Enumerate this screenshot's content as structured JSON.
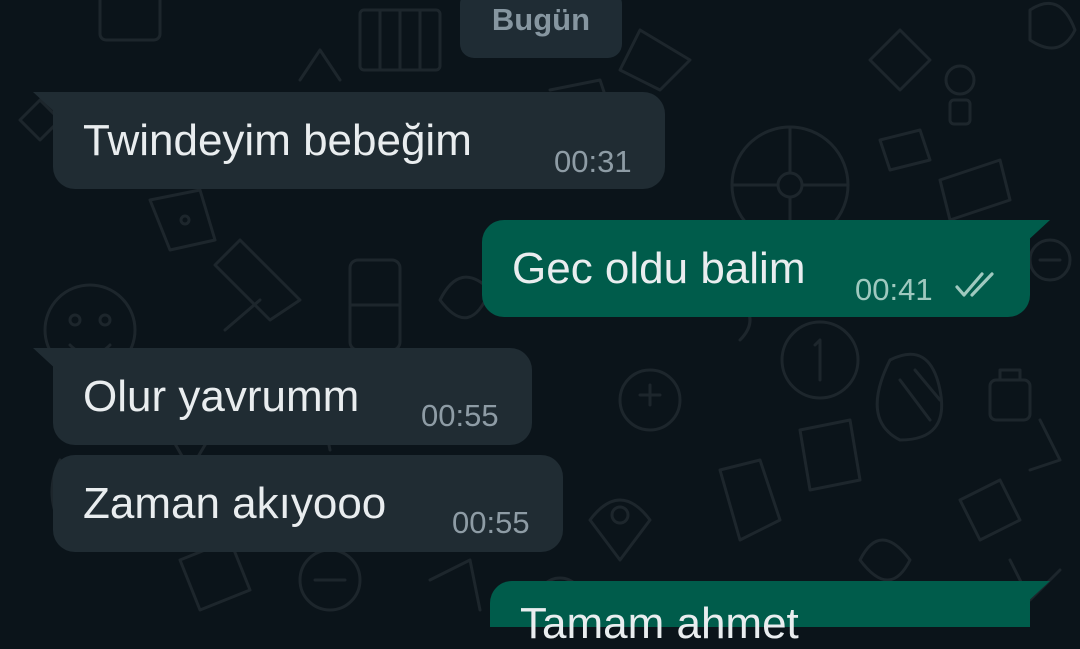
{
  "chat": {
    "date_divider": "Bugün",
    "messages": [
      {
        "direction": "incoming",
        "text": "Twindeyim bebeğim",
        "time": "00:31"
      },
      {
        "direction": "outgoing",
        "text": "Gec oldu balim",
        "time": "00:41",
        "status": "read-double-tick"
      },
      {
        "direction": "incoming",
        "text": "Olur yavrumm",
        "time": "00:55"
      },
      {
        "direction": "incoming",
        "text": "Zaman akıyooo",
        "time": "00:55"
      },
      {
        "direction": "outgoing",
        "text": "Tamam ahmet",
        "time": ""
      }
    ]
  },
  "colors": {
    "background": "#0b141a",
    "incoming_bubble": "#202c33",
    "outgoing_bubble": "#005c4b",
    "text": "#e9edef",
    "timestamp": "#8e9ca5",
    "read_ticks": "#9fc9bf"
  }
}
